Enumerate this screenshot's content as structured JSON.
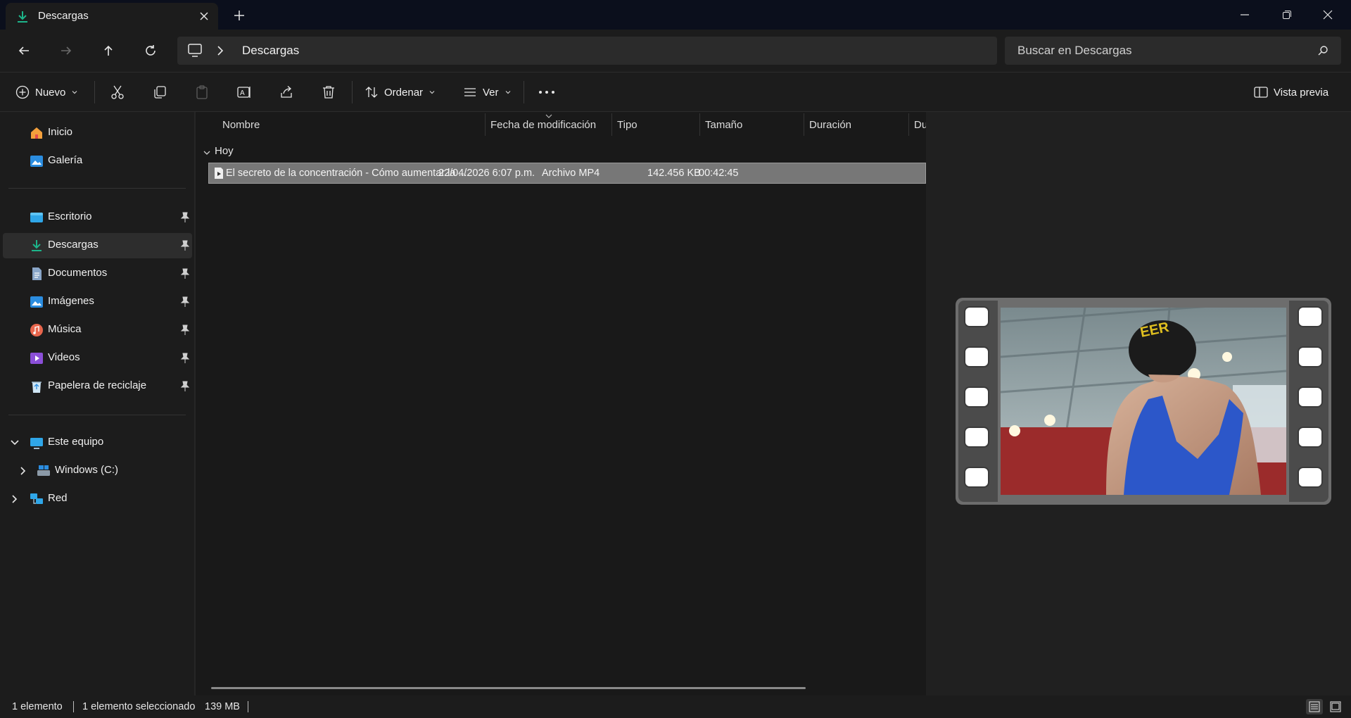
{
  "window": {
    "tab_title": "Descargas",
    "new_tab_symbol": "+"
  },
  "address": {
    "path": "Descargas",
    "search_placeholder": "Buscar en Descargas"
  },
  "commands": {
    "new_label": "Nuevo",
    "sort_label": "Ordenar",
    "view_label": "Ver",
    "preview_label": "Vista previa"
  },
  "sidebar": {
    "items": [
      {
        "label": "Inicio",
        "icon": "home-icon"
      },
      {
        "label": "Galería",
        "icon": "gallery-icon"
      },
      {
        "label": "Escritorio",
        "icon": "desktop-folder-icon",
        "pinned": true
      },
      {
        "label": "Descargas",
        "icon": "download-icon",
        "pinned": true,
        "selected": true
      },
      {
        "label": "Documentos",
        "icon": "documents-icon",
        "pinned": true
      },
      {
        "label": "Imágenes",
        "icon": "pictures-icon",
        "pinned": true
      },
      {
        "label": "Música",
        "icon": "music-icon",
        "pinned": true
      },
      {
        "label": "Videos",
        "icon": "videos-icon",
        "pinned": true
      },
      {
        "label": "Papelera de reciclaje",
        "icon": "recycle-bin-icon",
        "pinned": true
      },
      {
        "label": "Este equipo",
        "icon": "this-pc-icon",
        "expanded": true
      },
      {
        "label": "Windows (C:)",
        "icon": "drive-icon"
      },
      {
        "label": "Red",
        "icon": "network-icon"
      }
    ]
  },
  "filelist": {
    "columns": [
      "Nombre",
      "Fecha de modificación",
      "Tipo",
      "Tamaño",
      "Duración",
      "Du"
    ],
    "group": "Hoy",
    "rows": [
      {
        "name": "El secreto de la concentración - Cómo aumentar la ...",
        "date": "22/04/2026 6:07 p.m.",
        "type": "Archivo MP4",
        "size": "142.456 KB",
        "duration": "00:42:45"
      }
    ]
  },
  "status": {
    "count": "1 elemento",
    "selected": "1 elemento seleccionado",
    "size": "139 MB"
  },
  "colors": {
    "accent_green": "#1db48a",
    "selection": "#777777"
  }
}
